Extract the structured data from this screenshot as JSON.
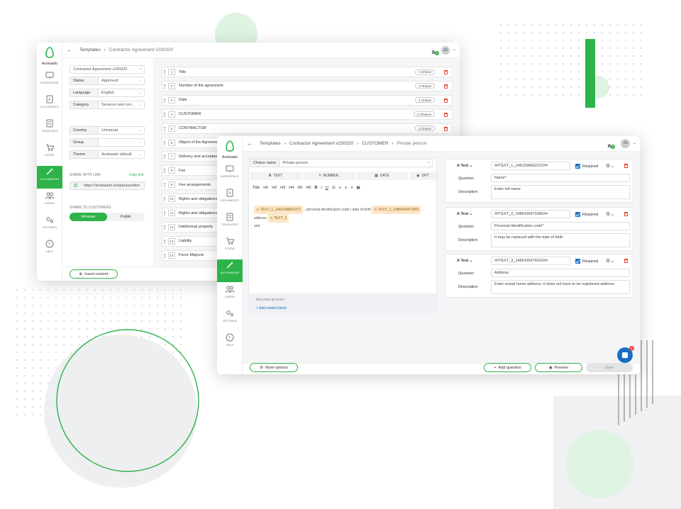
{
  "brand": {
    "name": "Avokaado",
    "accent": "#2db34a"
  },
  "back_window": {
    "breadcrumb": [
      "Templates",
      "Contractor Agreement v230320"
    ],
    "notification_count": "4",
    "avatar": "JG",
    "nav": [
      {
        "label": "Workspace",
        "icon": "monitor-icon"
      },
      {
        "label": "Documents",
        "icon": "document-icon"
      },
      {
        "label": "Templates",
        "icon": "templates-icon"
      },
      {
        "label": "Store",
        "icon": "cart-icon"
      },
      {
        "label": "Automation",
        "icon": "magic-wand-icon",
        "active": true
      },
      {
        "label": "Users",
        "icon": "users-icon"
      },
      {
        "label": "Settings",
        "icon": "settings-icon"
      },
      {
        "label": "Help",
        "icon": "help-icon"
      }
    ],
    "template_name": "Contractor Agreement v230320",
    "fields": [
      {
        "label": "Status",
        "value": "Approved"
      },
      {
        "label": "Language",
        "value": "English"
      },
      {
        "label": "Category",
        "value": "Services and coo..."
      },
      {
        "label": "Country",
        "value": "Universal"
      },
      {
        "label": "Group",
        "value": ""
      },
      {
        "label": "Theme",
        "value": "Avokaado default"
      }
    ],
    "share_link_label": "SHARE WITH LINK",
    "copy_link": "Copy link",
    "share_url": "https://avokaado.io/app/question",
    "share_customers_label": "SHARE TO CUSTOMERS",
    "share_toggle": [
      "Inhouse",
      "Public"
    ],
    "insert_content": "Insert content",
    "blocks": [
      {
        "num": "1",
        "title": "Title",
        "choice": "1 Choice"
      },
      {
        "num": "2",
        "title": "Number of the agreement",
        "choice": "2 Choice"
      },
      {
        "num": "3",
        "title": "Date",
        "choice": "1 Choice"
      },
      {
        "num": "4",
        "title": "CUSTOMER",
        "choice": "2 Choices"
      },
      {
        "num": "5",
        "title": "CONTRACTOR",
        "choice": "2 Choice"
      },
      {
        "num": "6",
        "title": "Object of the Agreement",
        "choice": ""
      },
      {
        "num": "7",
        "title": "Delivery and acceptance",
        "choice": ""
      },
      {
        "num": "8",
        "title": "Fee",
        "choice": ""
      },
      {
        "num": "9",
        "title": "Fee arrangements",
        "choice": ""
      },
      {
        "num": "10",
        "title": "Rights and obligations",
        "choice": ""
      },
      {
        "num": "11",
        "title": "Rights and obligations",
        "choice": ""
      },
      {
        "num": "12",
        "title": "Intellectual property",
        "choice": ""
      },
      {
        "num": "13",
        "title": "Liability",
        "choice": ""
      },
      {
        "num": "14",
        "title": "Force Majeure",
        "choice": ""
      }
    ]
  },
  "front_window": {
    "breadcrumb": [
      "Templates",
      "Contractor Agreement v230320",
      "CUSTOMER",
      "Private person"
    ],
    "notification_count": "4",
    "avatar": "JG",
    "choice_name_label": "Choice name",
    "choice_name_value": "Private person",
    "insert_buttons": [
      "TEXT",
      "NUMBER",
      "DATE",
      "OPT"
    ],
    "toolbar": [
      "Title",
      "H1",
      "H2",
      "H3",
      "H4",
      "H5",
      "H6",
      "B",
      "I",
      "U"
    ],
    "editor_tags": [
      "TEXT_1_1461598652372",
      "TEXT_2_1485435471892",
      "TEXT_3"
    ],
    "editor_text_1": ", personal identification code / date of birth",
    "editor_text_2": ", address",
    "editor_text_and": "and",
    "related_blocks_label": "RELATED BLOCKS",
    "add_related": "+ Add related block",
    "more_options": "More options",
    "add_question": "Add question",
    "preview": "Preview",
    "save": "Save",
    "questions": [
      {
        "type": "Text",
        "id": "##TEXT_1_1461598652372##",
        "required": "Required",
        "question": "Name*",
        "description": "Enter full name"
      },
      {
        "type": "Text",
        "id": "##TEXT_2_1485435471892##",
        "required": "Required",
        "question": "Personal identification code*",
        "description": "It may be replaced with the date of birth."
      },
      {
        "type": "Text",
        "id": "##TEXT_3_1485435476910##",
        "required": "Required",
        "question": "Address",
        "description": "Enter actual home address. It does not have to be registered address."
      }
    ],
    "question_label": "Question",
    "description_label": "Description",
    "chat_badge": "1"
  }
}
